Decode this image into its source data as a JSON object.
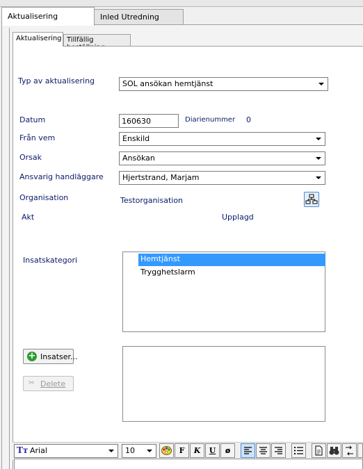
{
  "outer_tabs": [
    {
      "label": "Aktualisering",
      "active": true
    },
    {
      "label": "Inled Utredning",
      "active": false
    }
  ],
  "inner_tabs": [
    {
      "label": "Aktualisering",
      "active": true
    },
    {
      "label": "Tillfällig beställning",
      "active": false
    }
  ],
  "form": {
    "typ_label": "Typ av aktualisering",
    "typ_value": "SOL ansökan hemtjänst",
    "datum_label": "Datum",
    "datum_value": "160630",
    "diarie_label": "Diarienummer",
    "diarie_value": "0",
    "fran_label": "Från vem",
    "fran_value": "Enskild",
    "orsak_label": "Orsak",
    "orsak_value": "Ansökan",
    "ansvarig_label": "Ansvarig handläggare",
    "ansvarig_value": "Hjertstrand, Marjam",
    "org_label": "Organisation",
    "org_value": "Testorganisation",
    "org_icon": "organization-tree-icon",
    "akt_label": "Akt",
    "akt_value": "Upplagd"
  },
  "insats": {
    "label": "Insatskategori",
    "items": [
      "Hemtjänst",
      "Trygghetslarm"
    ],
    "selected_index": 0,
    "add_button": "Insatser...",
    "add_icon": "plus-circle-icon",
    "delete_button": "Delete",
    "delete_icon": "delete-icon"
  },
  "toolbar": {
    "font_name": "Arial",
    "font_size": "10",
    "bold": "F",
    "italic": "K",
    "underline": "U",
    "strike": "ø"
  },
  "colors": {
    "selection": "#3399ff",
    "label_blue": "#0a1a6a",
    "add_green": "#2e9b2e"
  }
}
